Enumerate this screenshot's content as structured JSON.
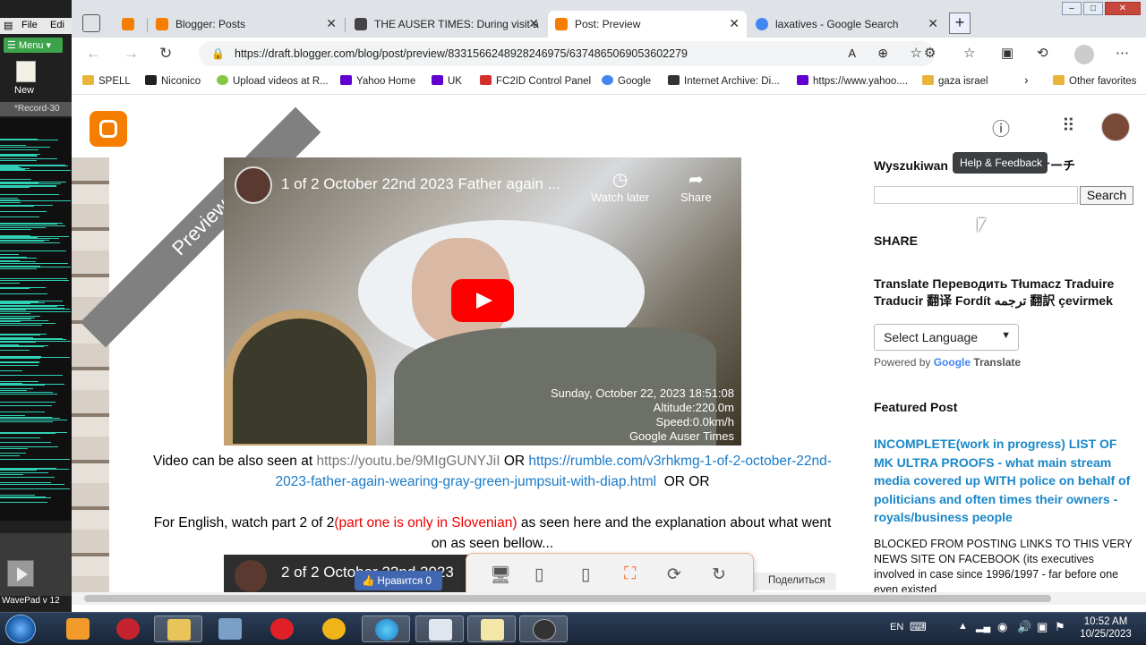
{
  "wavepad": {
    "menu_file": "File",
    "menu_edit": "Edi",
    "menu_button": "Menu",
    "new_label": "New",
    "record_tab": "*Record-30",
    "status": "WavePad v 12"
  },
  "browser": {
    "tabs": [
      {
        "label": "",
        "favicon_color": "#f57d00"
      },
      {
        "label": "Blogger: Posts",
        "favicon_color": "#f57d00"
      },
      {
        "label": "THE AUSER TIMES: During visit a",
        "favicon_color": "#444444"
      },
      {
        "label": "Post: Preview",
        "favicon_color": "#f57d00"
      },
      {
        "label": "laxatives - Google Search",
        "favicon_color": "#4285f4"
      }
    ],
    "url": "https://draft.blogger.com/blog/post/preview/8331566248928246975/6374865069053602279",
    "bookmarks": [
      {
        "label": "SPELL",
        "color": "#e9b43b"
      },
      {
        "label": "Niconico",
        "color": "#222222"
      },
      {
        "label": "Upload videos at R...",
        "color": "#85c742"
      },
      {
        "label": "Yahoo Home",
        "color": "#6001d2"
      },
      {
        "label": "UK",
        "color": "#6001d2"
      },
      {
        "label": "FC2ID Control Panel",
        "color": "#d32f2f"
      },
      {
        "label": "Google",
        "color": "#4285f4"
      },
      {
        "label": "Internet Archive: Di...",
        "color": "#333333"
      },
      {
        "label": "https://www.yahoo....",
        "color": "#6001d2"
      },
      {
        "label": "gaza israel",
        "color": "#e9b43b"
      },
      {
        "label": "Other favorites",
        "color": "#e9b43b"
      }
    ]
  },
  "page": {
    "preview_ribbon": "Preview",
    "video1": {
      "title": "1 of 2 October 22nd 2023 Father again ...",
      "watch_later": "Watch later",
      "share": "Share",
      "info_date": "Sunday, October 22, 2023 18:51:08",
      "info_altitude": "Altitude:220.0m",
      "info_speed": "Speed:0.0km/h",
      "info_source": "Google Auser Times"
    },
    "line1_prefix": "Video can be also seen at",
    "line1_youtube": "https://youtu.be/9MIgGUNYJiI",
    "line1_or1": "OR",
    "line1_rumble": "https://rumble.com/v3rhkmg-1-of-2-october-22nd-2023-father-again-wearing-gray-green-jumpsuit-with-diap.html",
    "line1_or2": "OR   OR",
    "line2_a": "For English, watch part 2 of 2",
    "line2_red": "(part one is only in Slovenian)",
    "line2_b": " as seen here and the explanation about what went on as seen bellow...",
    "video2_title": "2 of 2 October 22nd 2023",
    "fb_like": "Нравится 0",
    "share_ru": "Поделиться",
    "help_tooltip": "Help & Feedback"
  },
  "sidebar": {
    "search_heading": "Wyszukiwan",
    "search_heading_tail": "ナーチ",
    "search_button": "Search",
    "share_heading": "SHARE",
    "translate_heading": "Translate Переводить Tłumacz Traduire Traducir 翻译 Fordít ترجمه 翻訳 çevirmek",
    "select_language": "Select Language",
    "powered_by": "Powered by",
    "google_word": "Google",
    "translate_word": "Translate",
    "featured_heading": "Featured Post",
    "featured_link": "INCOMPLETE(work in progress) LIST OF MK ULTRA PROOFS - what main stream media covered up WITH police on behalf of politicians and often times their owners - royals/business people",
    "blocked_text": "BLOCKED FROM POSTING LINKS TO THIS VERY NEWS SITE ON FACEBOOK (its executives involved in case since 1996/1997 - far before one even existed"
  },
  "taskbar": {
    "lang": "EN",
    "time": "10:52 AM",
    "date": "10/25/2023"
  }
}
